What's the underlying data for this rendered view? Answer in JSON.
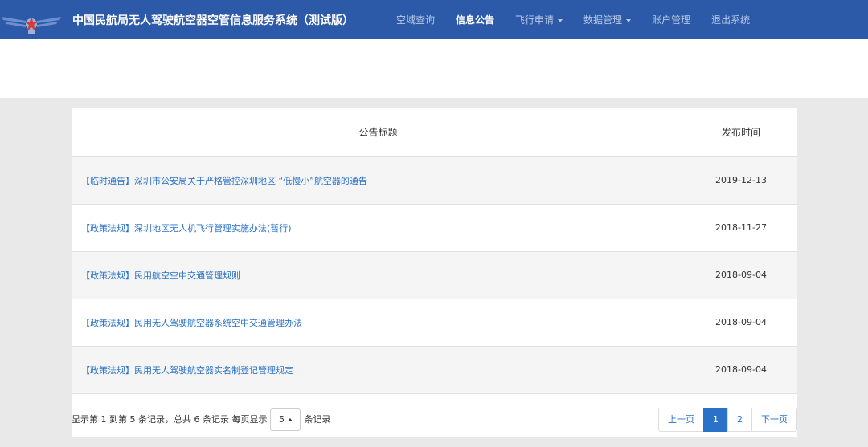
{
  "header": {
    "title": "中国民航局无人驾驶航空器空管信息服务系统（测试版）",
    "nav": [
      {
        "label": "空域查询",
        "active": false,
        "dropdown": false
      },
      {
        "label": "信息公告",
        "active": true,
        "dropdown": false
      },
      {
        "label": "飞行申请",
        "active": false,
        "dropdown": true
      },
      {
        "label": "数据管理",
        "active": false,
        "dropdown": true
      },
      {
        "label": "账户管理",
        "active": false,
        "dropdown": false
      },
      {
        "label": "退出系统",
        "active": false,
        "dropdown": false
      }
    ]
  },
  "table": {
    "columns": [
      "公告标题",
      "发布时间"
    ],
    "rows": [
      {
        "title": "【临时通告】深圳市公安局关于严格管控深圳地区 “低慢小”航空器的通告",
        "date": "2019-12-13"
      },
      {
        "title": "【政策法规】深圳地区无人机飞行管理实施办法(暂行)",
        "date": "2018-11-27"
      },
      {
        "title": "【政策法规】民用航空空中交通管理规则",
        "date": "2018-09-04"
      },
      {
        "title": "【政策法规】民用无人驾驶航空器系统空中交通管理办法",
        "date": "2018-09-04"
      },
      {
        "title": "【政策法规】民用无人驾驶航空器实名制登记管理规定",
        "date": "2018-09-04"
      }
    ]
  },
  "footer": {
    "info_prefix": "显示第 1 到第 5 条记录，总共 6 条记录 每页显示",
    "page_size": "5",
    "info_suffix": "条记录",
    "prev": "上一页",
    "pages": [
      "1",
      "2"
    ],
    "current_page": "1",
    "next": "下一页"
  },
  "colors": {
    "navbar": "#2d5aa8",
    "link": "#2a72c8",
    "logo_red": "#d83a36"
  },
  "icons": {
    "logo": "caac-wings-logo-icon",
    "dropdown": "caret-down-icon",
    "select": "caret-up-icon"
  }
}
